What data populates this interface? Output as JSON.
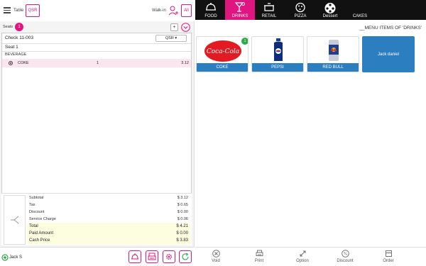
{
  "header": {
    "table_label": "Table",
    "table_value": "QSR",
    "walkin_label": "Walk-in",
    "all_label": "All"
  },
  "seats": {
    "label": "Seats",
    "count": "1",
    "add_label": "+"
  },
  "check": {
    "title": "Check 11-003",
    "type": "QSR ▾",
    "seat": "Seat 1",
    "group": "BEVERAGE",
    "items": [
      {
        "name": "COKE",
        "qty": "1",
        "price": "3.12"
      }
    ]
  },
  "totals": {
    "subtotal_label": "Subtotal",
    "subtotal": "$ 3.12",
    "tax_label": "Tax",
    "tax": "$ 0.65",
    "discount_label": "Discount",
    "discount": "$ 0.00",
    "service_label": "Service Charge",
    "service": "$ 0.06",
    "total_label": "Total",
    "total": "$ 4.21",
    "paid_label": "Paid Amount",
    "paid": "$ 0.00",
    "cash_label": "Cash Price",
    "cash": "$ 3.83"
  },
  "user": {
    "name": "Jack S"
  },
  "categories": [
    {
      "label": "FOOD",
      "icon": "cloche-icon"
    },
    {
      "label": "DRINKS",
      "icon": "cocktail-icon"
    },
    {
      "label": "RETAIL",
      "icon": "pot-icon"
    },
    {
      "label": "PIZZA",
      "icon": "pizza-icon"
    },
    {
      "label": "Dessert",
      "icon": "dessert-icon"
    },
    {
      "label": "CAKES",
      "icon": ""
    }
  ],
  "menu": {
    "title": "__MENU ITEMS OF 'DRINKS'",
    "items": [
      {
        "label": "COKE",
        "badge": "1"
      },
      {
        "label": "PEPSI"
      },
      {
        "label": "RED BULL"
      },
      {
        "label": "Jack daniel"
      }
    ]
  },
  "actions": [
    {
      "label": "Void",
      "icon": "void-icon"
    },
    {
      "label": "Print",
      "icon": "print-icon"
    },
    {
      "label": "Option",
      "icon": "option-icon"
    },
    {
      "label": "Discount",
      "icon": "discount-icon"
    },
    {
      "label": "Order",
      "icon": "order-icon"
    }
  ],
  "colors": {
    "accent": "#e0157f",
    "tile_blue": "#2b7fc1",
    "topbar": "#111111",
    "highlight": "#fdfde0",
    "row_highlight": "#fbe6f0"
  }
}
